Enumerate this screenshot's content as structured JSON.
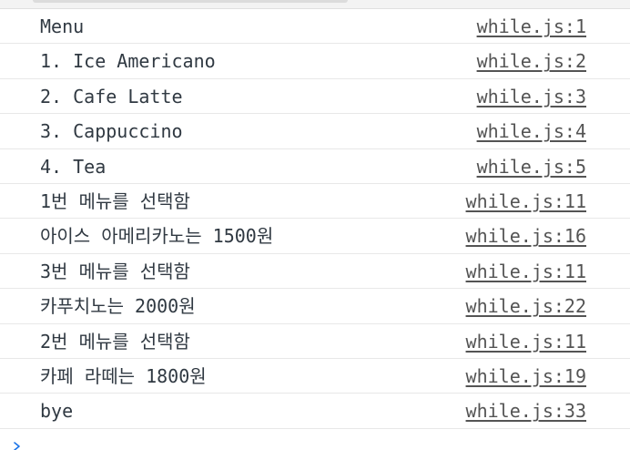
{
  "console": {
    "prompt_icon": "chevron-right-icon",
    "accent_color": "#1a73e8",
    "rows": [
      {
        "message": "Menu",
        "source": "while.js:1"
      },
      {
        "message": "1. Ice Americano",
        "source": "while.js:2"
      },
      {
        "message": "2. Cafe Latte",
        "source": "while.js:3"
      },
      {
        "message": "3. Cappuccino",
        "source": "while.js:4"
      },
      {
        "message": "4. Tea",
        "source": "while.js:5"
      },
      {
        "message": "1번 메뉴를 선택함",
        "source": "while.js:11"
      },
      {
        "message": "아이스 아메리카노는 1500원",
        "source": "while.js:16"
      },
      {
        "message": "3번 메뉴를 선택함",
        "source": "while.js:11"
      },
      {
        "message": "카푸치노는 2000원",
        "source": "while.js:22"
      },
      {
        "message": "2번 메뉴를 선택함",
        "source": "while.js:11"
      },
      {
        "message": "카페 라떼는 1800원",
        "source": "while.js:19"
      },
      {
        "message": "bye",
        "source": "while.js:33"
      }
    ]
  }
}
